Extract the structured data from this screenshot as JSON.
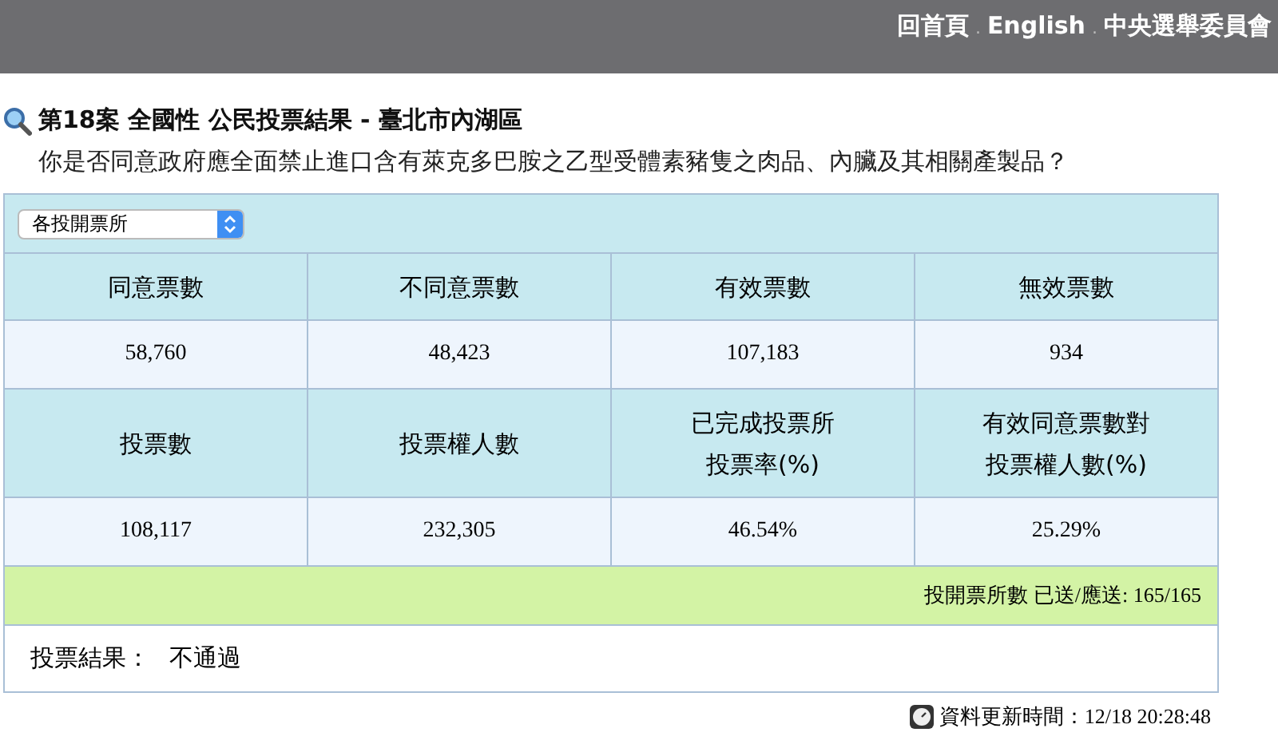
{
  "header": {
    "links": [
      "回首頁",
      "English",
      "中央選舉委員會"
    ],
    "separator": "."
  },
  "title": "第18案 全國性 公民投票結果 - 臺北市內湖區",
  "question": "你是否同意政府應全面禁止進口含有萊克多巴胺之乙型受體素豬隻之肉品、內臟及其相關產製品？",
  "select": {
    "value": "各投開票所"
  },
  "table": {
    "rows": [
      {
        "kind": "head",
        "cells": [
          [
            "同意票數"
          ],
          [
            "不同意票數"
          ],
          [
            "有效票數"
          ],
          [
            "無效票數"
          ]
        ]
      },
      {
        "kind": "value",
        "cells": [
          [
            "58,760"
          ],
          [
            "48,423"
          ],
          [
            "107,183"
          ],
          [
            "934"
          ]
        ]
      },
      {
        "kind": "head",
        "cells": [
          [
            "投票數"
          ],
          [
            "投票權人數"
          ],
          [
            "已完成投票所",
            "投票率(%)"
          ],
          [
            "有效同意票數對",
            "投票權人數(%)"
          ]
        ]
      },
      {
        "kind": "value",
        "cells": [
          [
            "108,117"
          ],
          [
            "232,305"
          ],
          [
            "46.54%"
          ],
          [
            "25.29%"
          ]
        ]
      }
    ]
  },
  "progress": "投開票所數 已送/應送: 165/165",
  "result": {
    "label": "投票結果：",
    "value": "不通過"
  },
  "updated": "資料更新時間：12/18 20:28:48"
}
